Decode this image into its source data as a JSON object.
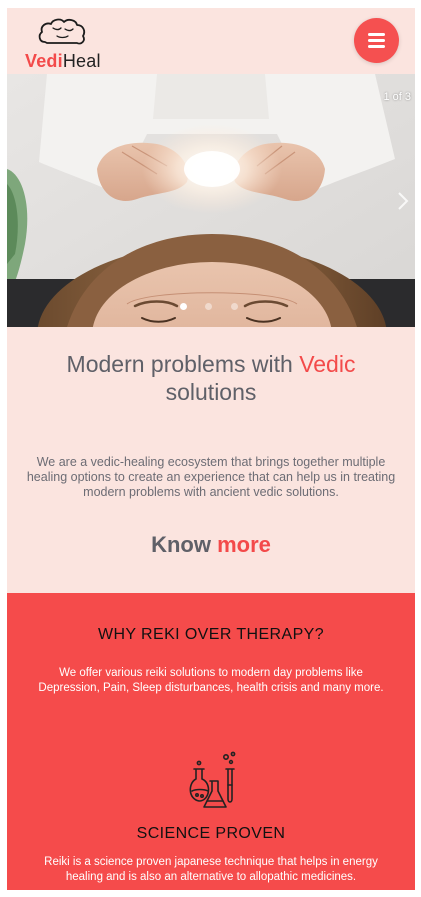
{
  "header": {
    "logo": {
      "part1": "Vedi",
      "part2": "Heal",
      "icon": "brain-icon"
    },
    "menu": {
      "icon": "hamburger-menu-icon"
    }
  },
  "hero": {
    "counter": "1 of 3",
    "slide_count": 3,
    "active_slide": 1,
    "next_icon": "chevron-right-icon"
  },
  "intro": {
    "headline_a": "Modern problems with ",
    "headline_accent": "Vedic",
    "headline_b": "solutions",
    "description": "We are a vedic-healing ecosystem that brings together multiple healing options to create an experience that can help us in treating modern problems with ancient vedic solutions.",
    "cta_a": "Know ",
    "cta_accent": "more"
  },
  "why": {
    "title": "WHY REKI OVER THERAPY?",
    "description": "We offer various reiki solutions to modern day problems like Depression, Pain, Sleep disturbances, health crisis and many more.",
    "feature": {
      "icon": "lab-flasks-icon",
      "title": "SCIENCE PROVEN",
      "description": "Reiki is a science proven japanese technique that helps in energy healing and is also an alternative to allopathic medicines."
    }
  },
  "colors": {
    "brand": "#f34a4a",
    "background": "#fbe4df",
    "section_red": "#f54b4b"
  }
}
